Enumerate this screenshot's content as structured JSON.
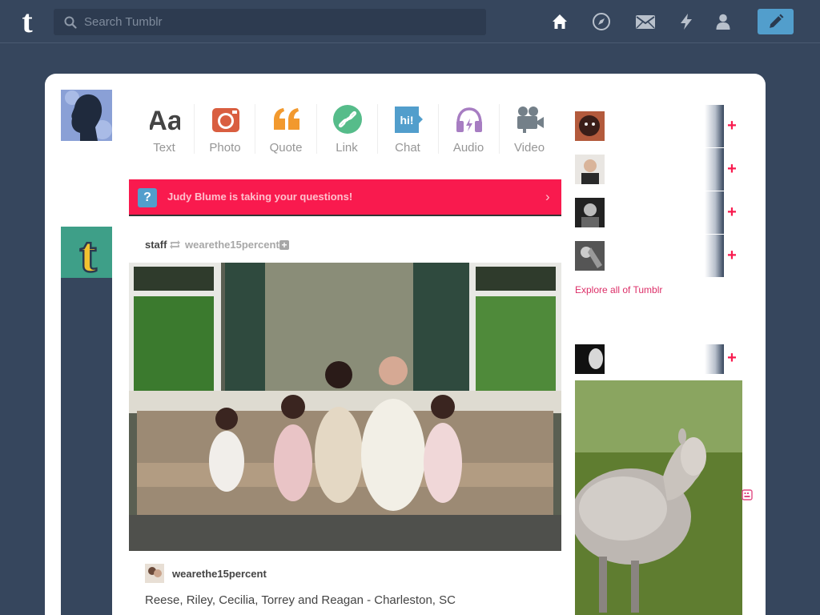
{
  "header": {
    "logo_letter": "t",
    "search_placeholder": "Search Tumblr",
    "nav_icons": [
      "home-icon",
      "explore-icon",
      "inbox-icon",
      "activity-icon",
      "account-icon"
    ],
    "compose_icon": "pencil-icon"
  },
  "post_types": [
    {
      "label": "Text",
      "icon": "text-icon",
      "color": "#444444"
    },
    {
      "label": "Photo",
      "icon": "camera-icon",
      "color": "#d95e40"
    },
    {
      "label": "Quote",
      "icon": "quote-icon",
      "color": "#f2992e"
    },
    {
      "label": "Link",
      "icon": "link-icon",
      "color": "#56bc8a"
    },
    {
      "label": "Chat",
      "icon": "chat-icon",
      "color": "#529ecc",
      "icon_text": "hi!"
    },
    {
      "label": "Audio",
      "icon": "headphones-icon",
      "color": "#a77dc2"
    },
    {
      "label": "Video",
      "icon": "video-camera-icon",
      "color": "#748089"
    }
  ],
  "banner": {
    "icon_text": "?",
    "text": "Judy Blume is taking your questions!",
    "chevron": "›",
    "color": "#f91a4e"
  },
  "post": {
    "user": "staff",
    "reblogged_from": "wearethe15percent",
    "caption_user": "wearethe15percent",
    "caption": "Reese, Riley, Cecilia, Torrey and Reagan - Charleston, SC"
  },
  "sidebar": {
    "follow_symbol": "+",
    "explore_link": "Explore all of Tumblr",
    "recommended_count_visible": 4
  },
  "colors": {
    "background": "#36465d",
    "accent_pink": "#f91a4e",
    "compose_blue": "#529ecc",
    "link_pink": "#dc2f68"
  }
}
